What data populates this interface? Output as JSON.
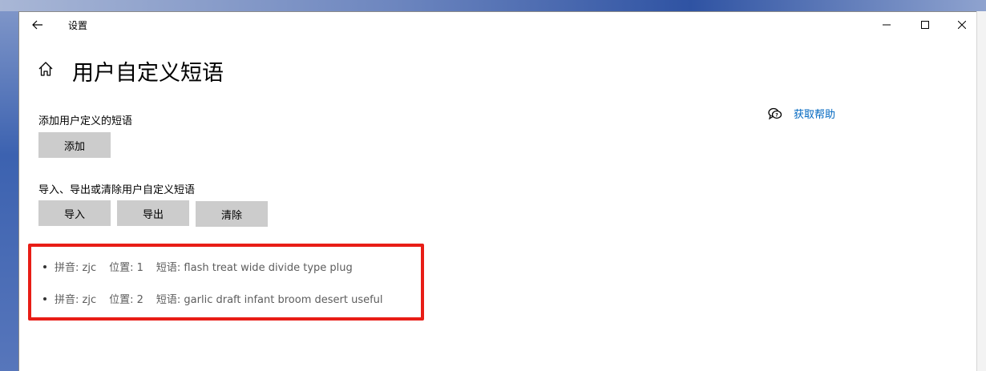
{
  "window": {
    "title": "设置",
    "controls": [
      "minimize",
      "maximize",
      "close"
    ]
  },
  "page": {
    "title": "用户自定义短语"
  },
  "add_section": {
    "label": "添加用户定义的短语",
    "add_button": "添加"
  },
  "manage_section": {
    "label": "导入、导出或清除用户自定义短语",
    "import_button": "导入",
    "export_button": "导出",
    "clear_button": "清除"
  },
  "help": {
    "label": "获取帮助"
  },
  "phrases": [
    {
      "pinyin": "拼音: zjc",
      "position": "位置: 1",
      "phrase": "短语: flash treat wide divide type plug"
    },
    {
      "pinyin": "拼音: zjc",
      "position": "位置: 2",
      "phrase": "短语: garlic draft infant broom desert useful"
    }
  ],
  "colors": {
    "accent": "#0067c0",
    "button_bg": "#cccccc",
    "highlight": "#e81d16"
  }
}
